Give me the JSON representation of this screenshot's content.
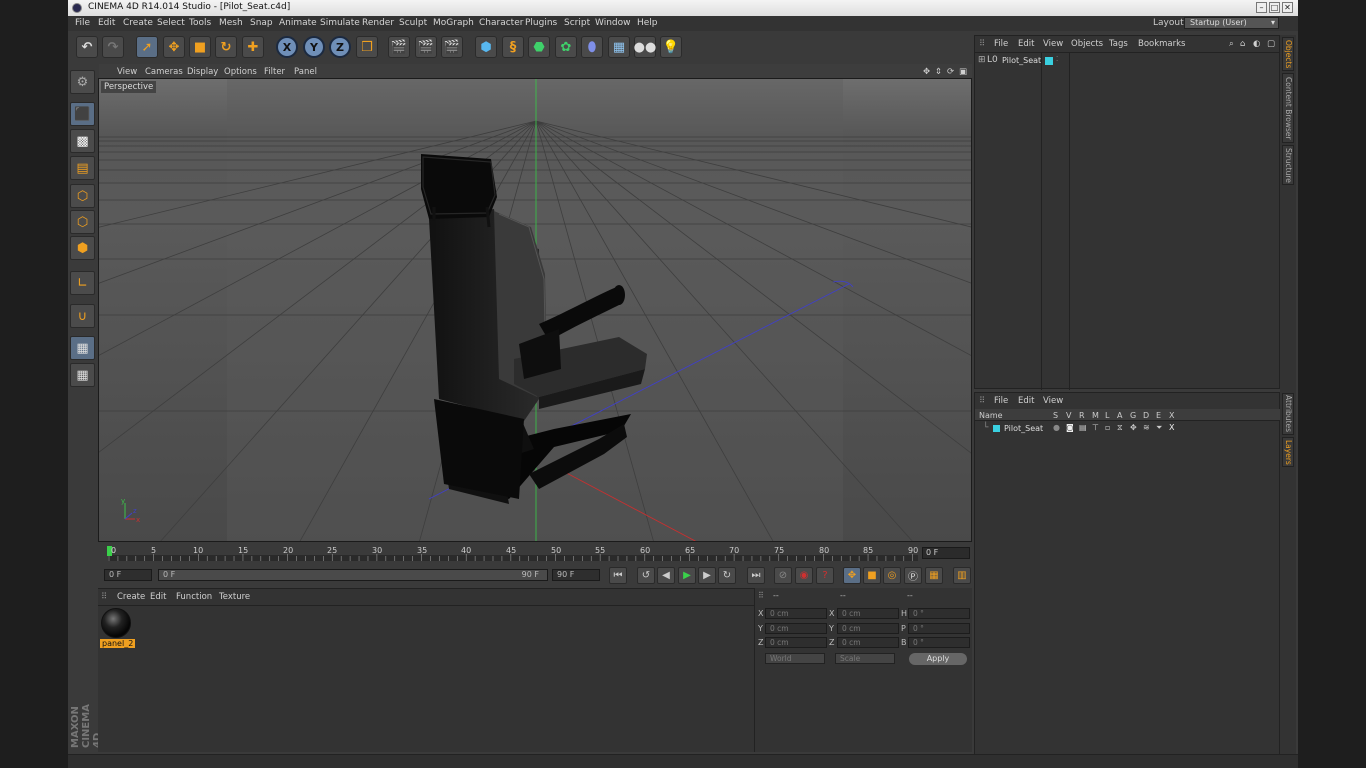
{
  "window": {
    "title": "CINEMA 4D R14.014 Studio - [Pilot_Seat.c4d]",
    "minimize": "–",
    "maximize": "□",
    "close": "✕"
  },
  "menubar": {
    "items": [
      "File",
      "Edit",
      "Create",
      "Select",
      "Tools",
      "Mesh",
      "Snap",
      "Animate",
      "Simulate",
      "Render",
      "Sculpt",
      "MoGraph",
      "Character",
      "Plugins",
      "Script",
      "Window",
      "Help"
    ],
    "layout_label": "Layout:",
    "layout_value": "Startup (User)"
  },
  "toolbar": {
    "undo": "↶",
    "redo": "↷",
    "axes": [
      "X",
      "Y",
      "Z"
    ]
  },
  "viewport": {
    "menu": [
      "View",
      "Cameras",
      "Display",
      "Options",
      "Filter",
      "Panel"
    ],
    "label": "Perspective",
    "axis_x": "x",
    "axis_y": "y",
    "axis_z": "z"
  },
  "timeline": {
    "ticks": [
      "0",
      "5",
      "10",
      "15",
      "20",
      "25",
      "30",
      "35",
      "40",
      "45",
      "50",
      "55",
      "60",
      "65",
      "70",
      "75",
      "80",
      "85",
      "90"
    ],
    "current_frame": "0 F",
    "start": "0 F",
    "range_start": "0 F",
    "range_end": "90 F",
    "end": "90 F"
  },
  "materials": {
    "menu": [
      "Create",
      "Edit",
      "Function",
      "Texture"
    ],
    "items": [
      {
        "name": "panel_2"
      }
    ]
  },
  "coordinates": {
    "header": [
      "--",
      "--",
      "--"
    ],
    "rows": [
      {
        "a": "X",
        "av": "0 cm",
        "b": "X",
        "bv": "0 cm",
        "c": "H",
        "cv": "0 °"
      },
      {
        "a": "Y",
        "av": "0 cm",
        "b": "Y",
        "bv": "0 cm",
        "c": "P",
        "cv": "0 °"
      },
      {
        "a": "Z",
        "av": "0 cm",
        "b": "Z",
        "bv": "0 cm",
        "c": "B",
        "cv": "0 °"
      }
    ],
    "space": "World",
    "mode": "Scale",
    "apply": "Apply"
  },
  "objects": {
    "menu": [
      "File",
      "Edit",
      "View",
      "Objects",
      "Tags",
      "Bookmarks"
    ],
    "items": [
      {
        "name": "Pilot_Seat",
        "color": "#3ad0e0"
      }
    ]
  },
  "layers": {
    "menu": [
      "File",
      "Edit",
      "View"
    ],
    "columns": [
      "Name",
      "S",
      "V",
      "R",
      "M",
      "L",
      "A",
      "G",
      "D",
      "E",
      "X"
    ],
    "items": [
      {
        "name": "Pilot_Seat",
        "color": "#3ad0e0"
      }
    ]
  },
  "side_tabs": [
    "Objects",
    "Content Browser",
    "Structure",
    "Attributes",
    "Layers"
  ],
  "brand": "MAXON CINEMA 4D",
  "colors": {
    "accent": "#f0a020",
    "selection": "#5a6e86",
    "layer_color": "#3ad0e0"
  }
}
